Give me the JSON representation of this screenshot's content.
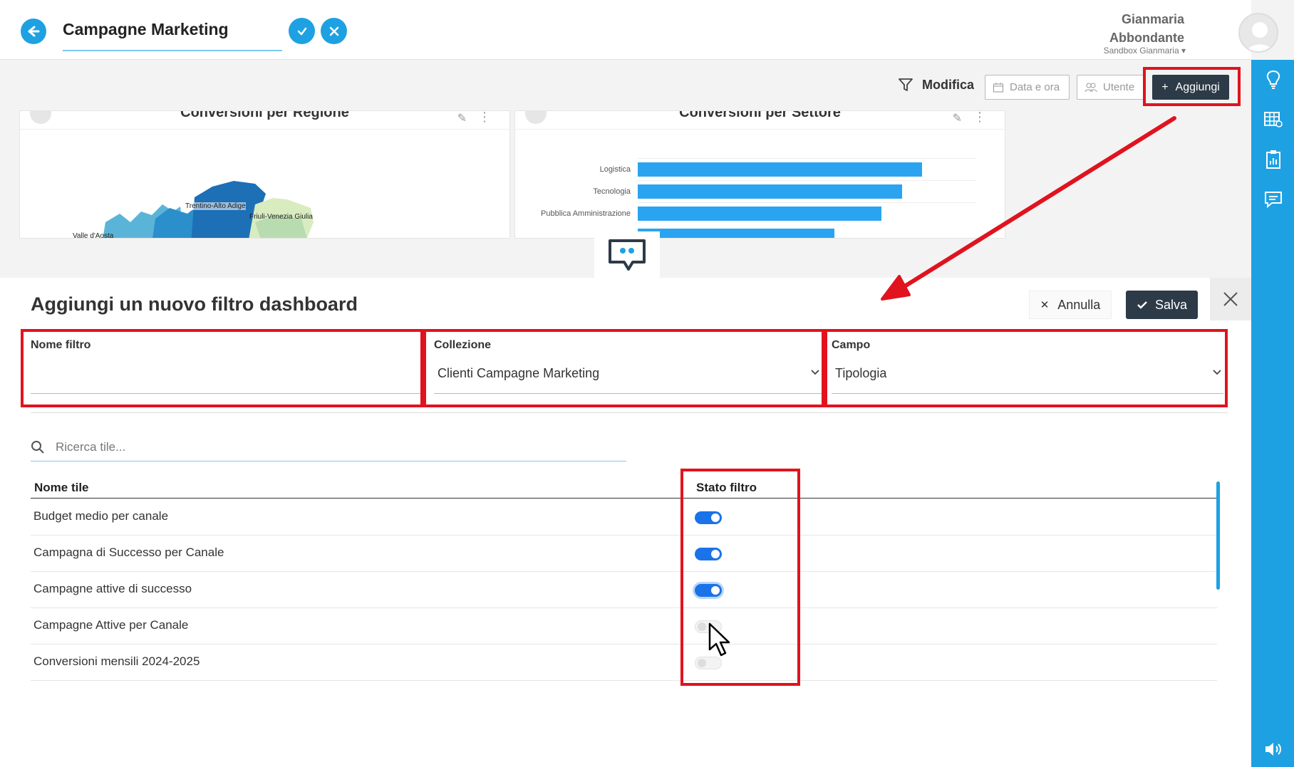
{
  "header": {
    "title": "Campagne Marketing",
    "user_first": "Gianmaria",
    "user_last": "Abbondante",
    "workspace": "Sandbox Gianmaria ▾"
  },
  "toolbar": {
    "modifica": "Modifica",
    "data_ora": "Data e ora",
    "utente": "Utente",
    "aggiungi": "Aggiungi"
  },
  "tiles": [
    {
      "title": "Conversioni per Regione",
      "map_labels": [
        "Trentino-Alto Adige",
        "Friuli-Venezia Giulia",
        "Valle d'Aosta"
      ]
    },
    {
      "title": "Conversioni per Settore",
      "chart_data": {
        "type": "bar",
        "categories": [
          "Logistica",
          "Tecnologia",
          "Pubblica Amministrazione"
        ],
        "values": [
          84,
          78,
          72
        ]
      }
    }
  ],
  "panel": {
    "title": "Aggiungi un nuovo filtro dashboard",
    "annulla": "Annulla",
    "salva": "Salva",
    "fields": {
      "nome_filtro": {
        "label": "Nome filtro",
        "value": ""
      },
      "collezione": {
        "label": "Collezione",
        "value": "Clienti Campagne Marketing"
      },
      "campo": {
        "label": "Campo",
        "value": "Tipologia"
      }
    },
    "search_placeholder": "Ricerca tile...",
    "columns": {
      "name": "Nome tile",
      "state": "Stato filtro"
    },
    "rows": [
      {
        "name": "Budget medio per canale",
        "on": true
      },
      {
        "name": "Campagna di Successo per Canale",
        "on": true
      },
      {
        "name": "Campagne attive di successo",
        "on": true
      },
      {
        "name": "Campagne Attive per Canale",
        "on": false
      },
      {
        "name": "Conversioni mensili 2024-2025",
        "on": false
      }
    ]
  },
  "colors": {
    "accent": "#1ea1e3",
    "dark_button": "#2d3a47",
    "toggle_on": "#1a73e8",
    "annotation_red": "#e0131e"
  }
}
